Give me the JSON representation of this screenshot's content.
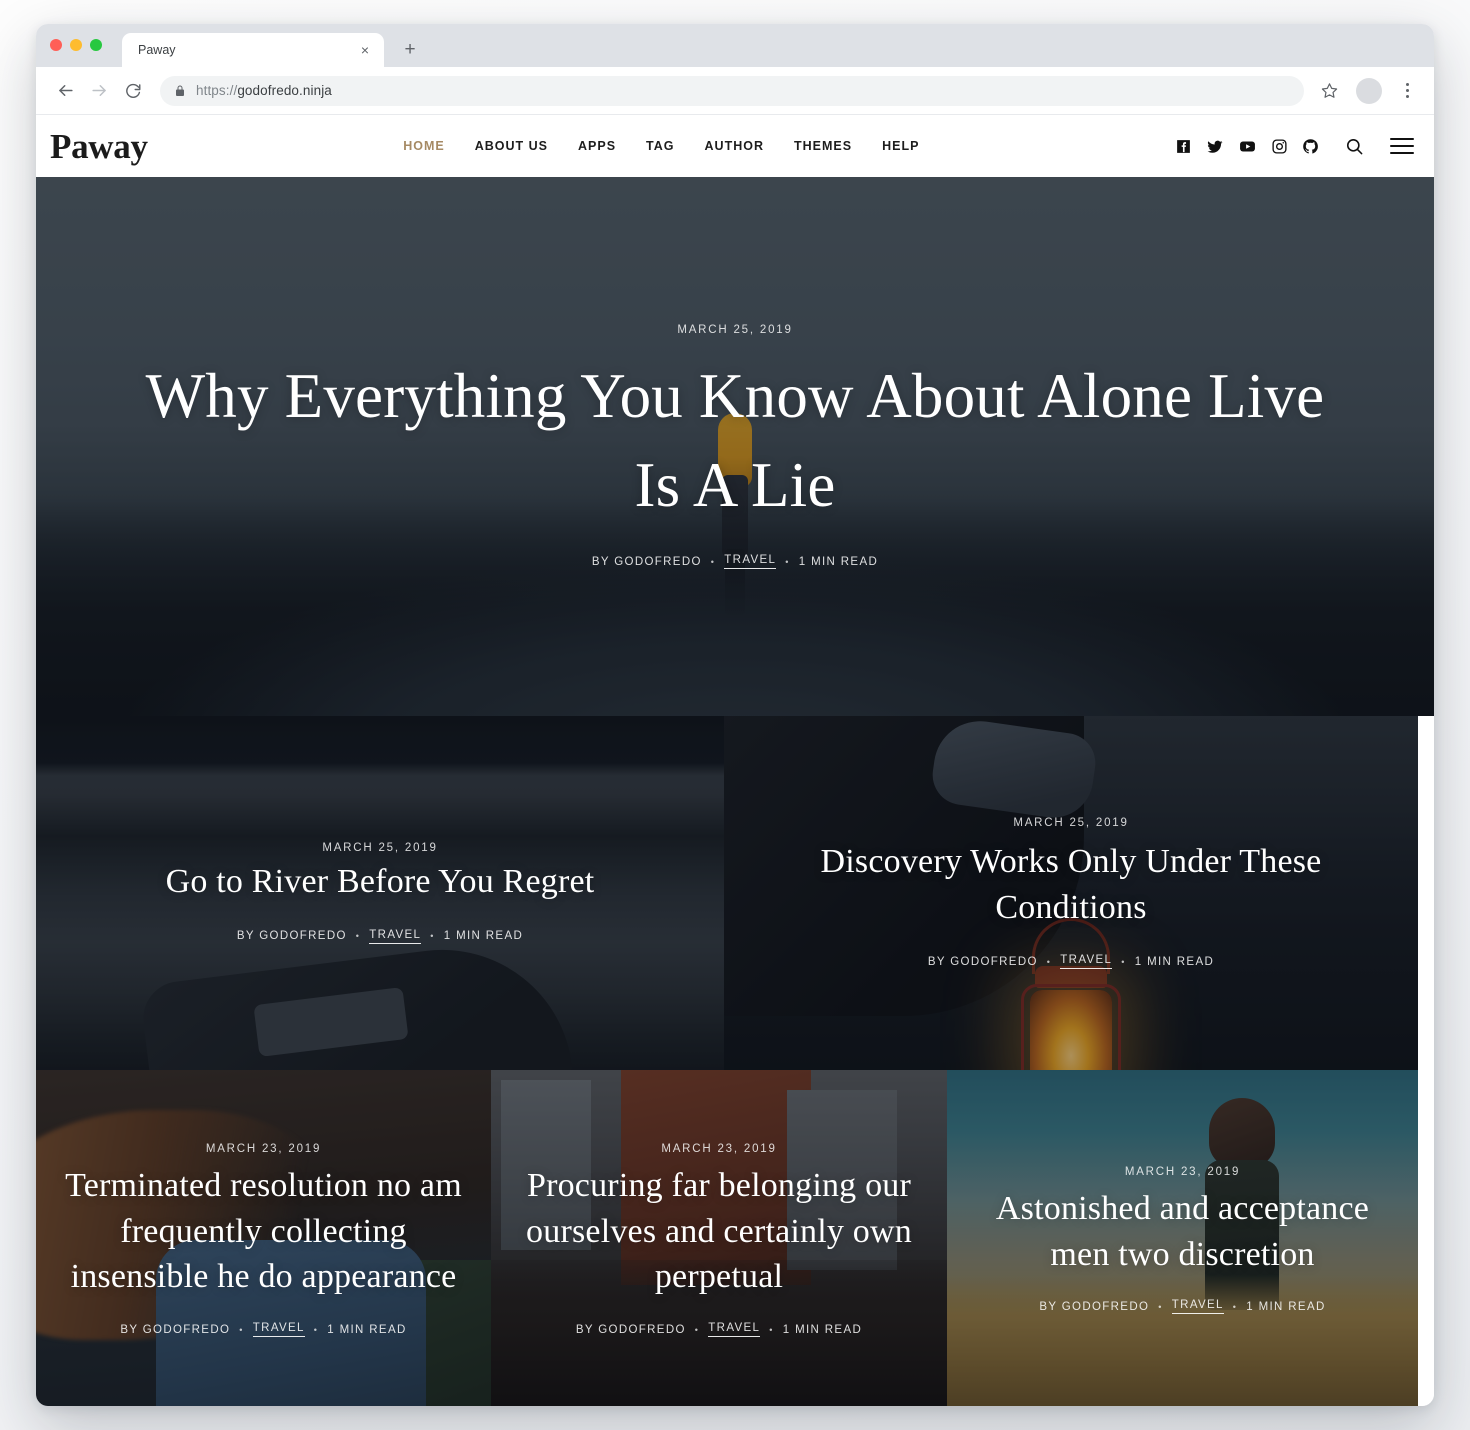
{
  "browser": {
    "tab_title": "Paway",
    "tab_close_glyph": "×",
    "new_tab_glyph": "+",
    "url_scheme": "https://",
    "url_host": "godofredo.ninja",
    "url_full": "https://godofredo.ninja"
  },
  "site": {
    "logo": "Paway",
    "nav": [
      {
        "label": "HOME",
        "active": true
      },
      {
        "label": "ABOUT US",
        "active": false
      },
      {
        "label": "APPS",
        "active": false
      },
      {
        "label": "TAG",
        "active": false
      },
      {
        "label": "AUTHOR",
        "active": false
      },
      {
        "label": "THEMES",
        "active": false
      },
      {
        "label": "HELP",
        "active": false
      }
    ],
    "social": [
      "facebook-icon",
      "twitter-icon",
      "youtube-icon",
      "instagram-icon",
      "github-icon"
    ],
    "search_icon": "search-icon",
    "menu_icon": "hamburger-icon",
    "accent_color": "#a68a64"
  },
  "posts": {
    "hero": {
      "date": "MARCH 25, 2019",
      "title": "Why Everything You Know About Alone Live Is A Lie",
      "author": "BY GODOFREDO",
      "tag": "TRAVEL",
      "read_time": "1 MIN READ",
      "sep": "•"
    },
    "mid_left": {
      "date": "MARCH 25, 2019",
      "title": "Go to River Before You Regret",
      "author": "BY GODOFREDO",
      "tag": "TRAVEL",
      "read_time": "1 MIN READ",
      "sep": "•"
    },
    "mid_right": {
      "date": "MARCH 25, 2019",
      "title": "Discovery Works Only Under These Conditions",
      "author": "BY GODOFREDO",
      "tag": "TRAVEL",
      "read_time": "1 MIN READ",
      "sep": "•"
    },
    "bottom_left": {
      "date": "MARCH 23, 2019",
      "title": "Terminated resolution no am frequently collecting insensible he do appearance",
      "author": "BY GODOFREDO",
      "tag": "TRAVEL",
      "read_time": "1 MIN READ",
      "sep": "•"
    },
    "bottom_center": {
      "date": "MARCH 23, 2019",
      "title": "Procuring far belonging our ourselves and certainly own perpetual",
      "author": "BY GODOFREDO",
      "tag": "TRAVEL",
      "read_time": "1 MIN READ",
      "sep": "•"
    },
    "bottom_right": {
      "date": "MARCH 23, 2019",
      "title": "Astonished and acceptance men two discretion",
      "author": "BY GODOFREDO",
      "tag": "TRAVEL",
      "read_time": "1 MIN READ",
      "sep": "•"
    }
  }
}
